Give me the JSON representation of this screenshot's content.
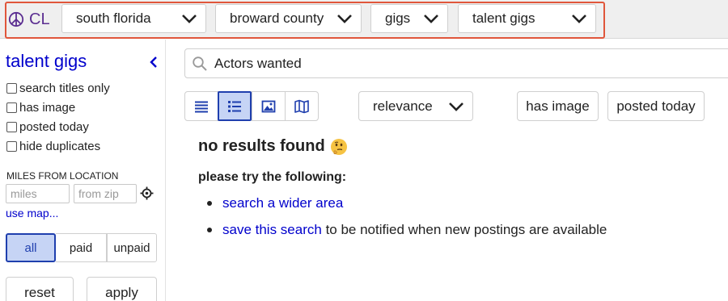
{
  "header": {
    "logo_text": "CL",
    "breadcrumbs": [
      {
        "label": "south florida"
      },
      {
        "label": "broward county"
      },
      {
        "label": "gigs"
      },
      {
        "label": "talent gigs"
      }
    ],
    "highlight_color": "#e0563b"
  },
  "sidebar": {
    "title": "talent gigs",
    "filters": [
      {
        "label": "search titles only",
        "checked": false
      },
      {
        "label": "has image",
        "checked": false
      },
      {
        "label": "posted today",
        "checked": false
      },
      {
        "label": "hide duplicates",
        "checked": false
      }
    ],
    "miles_label": "MILES FROM LOCATION",
    "miles_placeholder": "miles",
    "zip_placeholder": "from zip",
    "use_map": "use map...",
    "pay_options": [
      {
        "label": "all",
        "active": true
      },
      {
        "label": "paid",
        "active": false
      },
      {
        "label": "unpaid",
        "active": false
      }
    ],
    "reset_label": "reset",
    "apply_label": "apply"
  },
  "search": {
    "query": "Actors wanted"
  },
  "toolbar": {
    "views": [
      {
        "icon": "list-compact-icon",
        "active": false
      },
      {
        "icon": "list-detail-icon",
        "active": true
      },
      {
        "icon": "gallery-icon",
        "active": false
      },
      {
        "icon": "map-icon",
        "active": false
      }
    ],
    "sort_value": "relevance",
    "has_image_label": "has image",
    "posted_today_label": "posted today"
  },
  "results": {
    "no_results": "no results found",
    "try_following": "please try the following:",
    "suggestion_1_link": "search a wider area",
    "suggestion_2_link": "save this search",
    "suggestion_2_rest": " to be notified when new postings are available"
  },
  "colors": {
    "link": "#0000cc",
    "active_bg": "#c6d4f5",
    "active_border": "#1f3fae",
    "logo": "#5b2e91"
  }
}
